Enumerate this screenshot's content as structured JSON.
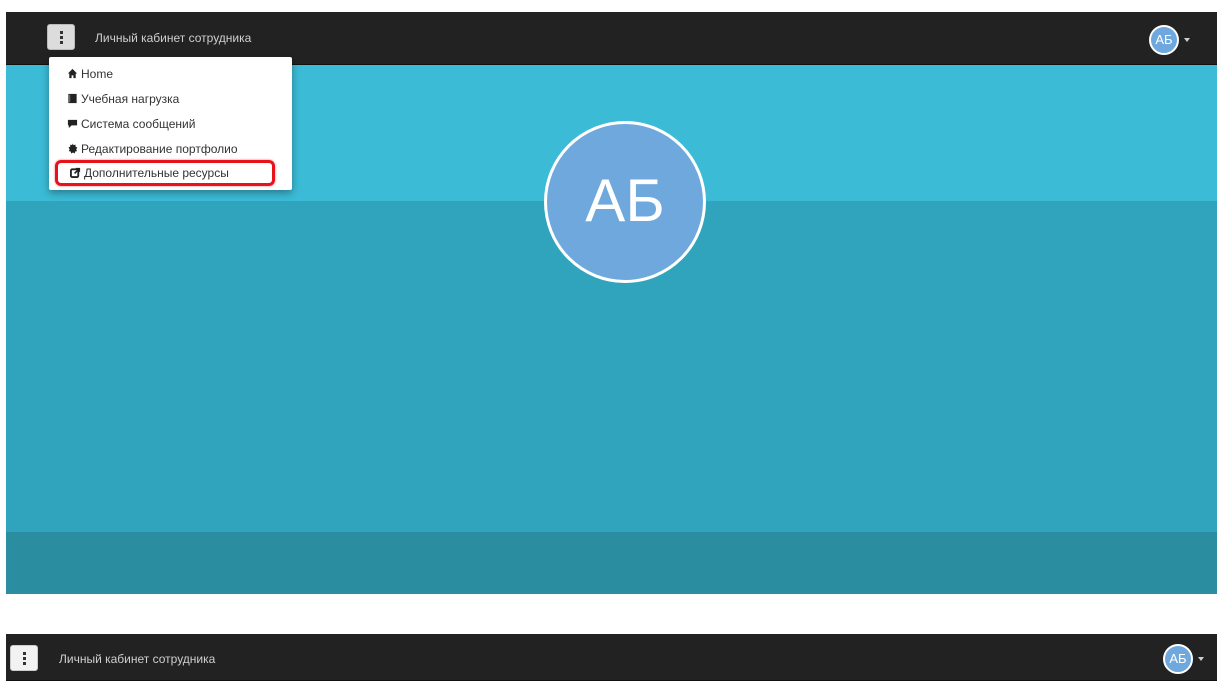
{
  "top_screen": {
    "navbar": {
      "title": "Личный кабинет сотрудника",
      "avatar_initials": "АБ"
    },
    "hero": {
      "avatar_initials": "АБ"
    },
    "dropdown": {
      "items": [
        {
          "label": "Home",
          "icon": "home-icon"
        },
        {
          "label": "Учебная нагрузка",
          "icon": "book-icon"
        },
        {
          "label": "Система сообщений",
          "icon": "comment-icon"
        },
        {
          "label": "Редактирование портфолио",
          "icon": "certificate-icon"
        },
        {
          "label": "Дополнительные ресурсы",
          "icon": "external-link-icon",
          "highlighted": true
        }
      ]
    }
  },
  "bottom_screen": {
    "navbar": {
      "title": "Личный кабинет сотрудника",
      "avatar_initials": "АБ"
    }
  },
  "colors": {
    "navbar_bg": "#222222",
    "hero_top": "#3bbbd6",
    "hero_mid": "#30a4bd",
    "hero_bottom": "#2a8da0",
    "avatar_bg": "#6fa8dc",
    "highlight_outline": "#e8121b"
  }
}
